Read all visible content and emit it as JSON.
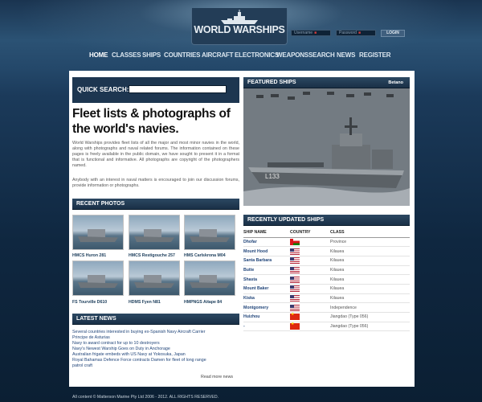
{
  "logo": {
    "text": "WORLD WARSHIPS"
  },
  "login": {
    "username_placeholder": "Username",
    "password_placeholder": "Password",
    "button": "LOGIN"
  },
  "nav": [
    "HOME",
    "CLASSES",
    "SHIPS",
    "COUNTRIES",
    "AIRCRAFT",
    "ELECTRONICS",
    "WEAPONS",
    "SEARCH",
    "NEWS",
    "REGISTER"
  ],
  "quick_search": {
    "label": "QUICK SEARCH:",
    "placeholder": ""
  },
  "intro": {
    "title": "Fleet lists & photographs of the world's navies.",
    "p1": "World Warships provides fleet lists of all the major and most minor navies in the world, along with photographs and naval related forums. The information contained on these pages is freely available in the public domain, we have sought to present it in a format that is functional and informative. All photographs are copyright of the photographers named.",
    "p2": "Anybody with an interest in naval matters is encouraged to join our discussion forums, provide information or photographs."
  },
  "featured": {
    "header": "FEATURED SHIPS",
    "ship_name": "Betano",
    "pennant": "L133"
  },
  "recent_photos": {
    "header": "RECENT PHOTOS",
    "items": [
      {
        "caption": "HMCS Huron 281"
      },
      {
        "caption": "HMCS Restigouche 257"
      },
      {
        "caption": "HMS Carlskrona M04"
      },
      {
        "caption": "FS Tourville D610"
      },
      {
        "caption": "HDMS Fyen N81"
      },
      {
        "caption": "HMPNGS Aitape 84"
      }
    ]
  },
  "latest_news": {
    "header": "LATEST NEWS",
    "items": [
      "Several countries interested in buying ex-Spanish Navy Aircraft Carrier",
      "Principe de Asturias",
      "Navy to award contract for up to 10 destroyers",
      "Navy's Newest Warship Goes on Duty in Anchorage",
      "Australian frigate embeds with US Navy at Yokosuka, Japan",
      "Royal Bahamas Defence Force contracts Damen for fleet of long range",
      "patrol craft"
    ],
    "more": "Read more news"
  },
  "recently_updated": {
    "header": "RECENTLY UPDATED SHIPS",
    "columns": [
      "SHIP NAME",
      "COUNTRY",
      "CLASS"
    ],
    "rows": [
      {
        "name": "Dhofar",
        "flag": "om",
        "class": "Province"
      },
      {
        "name": "Mount Hood",
        "flag": "us",
        "class": "Kilauea"
      },
      {
        "name": "Santa Barbara",
        "flag": "us",
        "class": "Kilauea"
      },
      {
        "name": "Butte",
        "flag": "us",
        "class": "Kilauea"
      },
      {
        "name": "Shasta",
        "flag": "us",
        "class": "Kilauea"
      },
      {
        "name": "Mount Baker",
        "flag": "us",
        "class": "Kilauea"
      },
      {
        "name": "Kiska",
        "flag": "us",
        "class": "Kilauea"
      },
      {
        "name": "Montgomery",
        "flag": "us",
        "class": "Independence"
      },
      {
        "name": "Huizhou",
        "flag": "cn",
        "class": "Jiangdao (Type 056)"
      },
      {
        "name": "-",
        "flag": "cn",
        "class": "Jiangdao (Type 056)"
      }
    ]
  },
  "footer": "All content © Matterson Marine Pty Ltd 2006 - 2012. ALL RIGHTS RESERVED."
}
